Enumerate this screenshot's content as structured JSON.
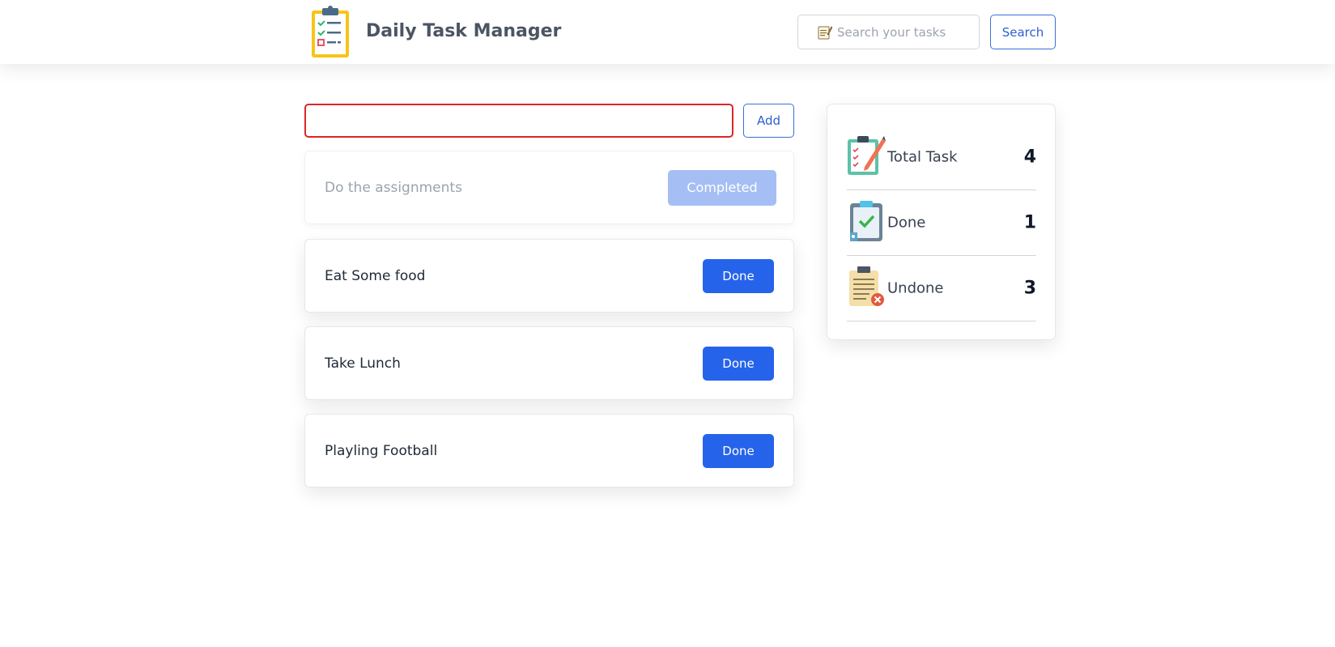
{
  "header": {
    "title": "Daily Task Manager",
    "search_placeholder": "Search your tasks",
    "search_value": "",
    "search_button": "Search"
  },
  "add_task": {
    "input_value": "",
    "add_button": "Add"
  },
  "tasks": [
    {
      "text": "Do the assignments",
      "status": "completed",
      "button": "Completed"
    },
    {
      "text": "Eat Some food",
      "status": "pending",
      "button": "Done"
    },
    {
      "text": "Take Lunch",
      "status": "pending",
      "button": "Done"
    },
    {
      "text": "Playling Football",
      "status": "pending",
      "button": "Done"
    }
  ],
  "stats": [
    {
      "label": "Total Task",
      "value": "4",
      "icon": "clipboard-pencil-icon"
    },
    {
      "label": "Done",
      "value": "1",
      "icon": "clipboard-check-icon"
    },
    {
      "label": "Undone",
      "value": "3",
      "icon": "clipboard-cross-icon"
    }
  ],
  "colors": {
    "primary": "#2563eb",
    "primary_light": "#a5bff5",
    "error_border": "#dc2626",
    "outline_blue": "#3b6fd9"
  }
}
